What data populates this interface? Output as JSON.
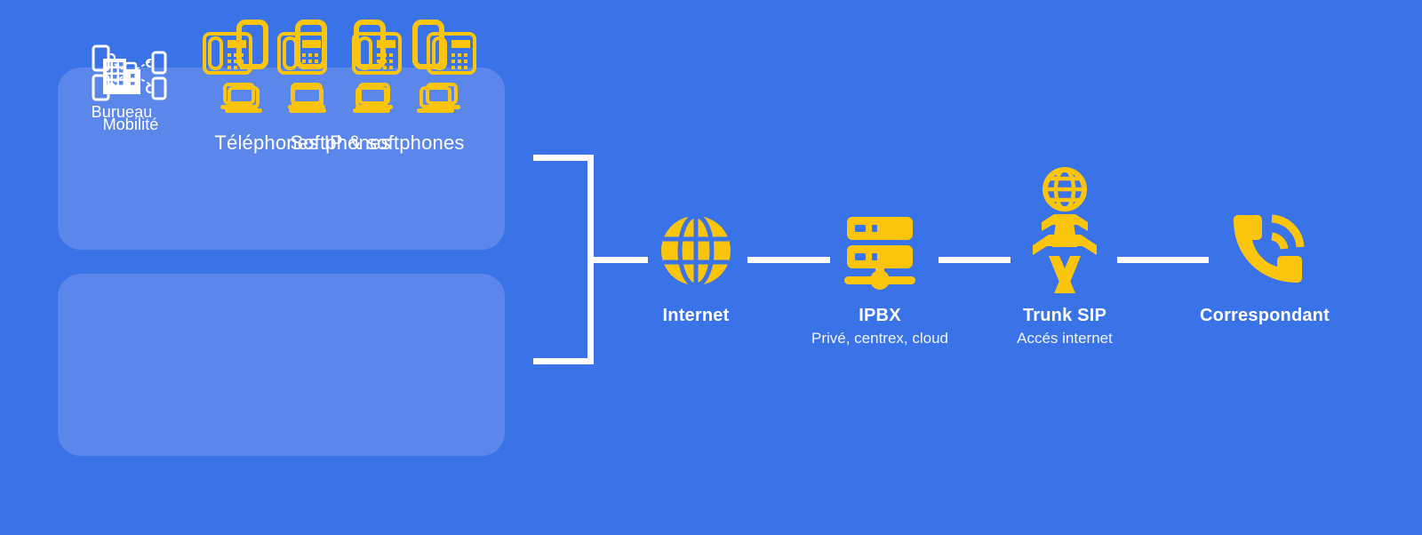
{
  "theme": {
    "background": "#3a72e8",
    "card_background": "#5b87ea",
    "accent_yellow": "#fbc40d",
    "text_white": "#ffffff"
  },
  "cards": [
    {
      "id": "office",
      "side_icon": "office-building-icon",
      "side_label": "Burueau",
      "device_rows": [
        {
          "icon": "desk-phone-icon",
          "count": 4
        },
        {
          "icon": "laptop-icon",
          "count": 4
        }
      ],
      "caption": "Téléphones IP & softphones"
    },
    {
      "id": "mobility",
      "side_icon": "mobility-network-icon",
      "side_label": "Mobilité",
      "device_rows": [
        {
          "icon": "smartphone-icon",
          "count": 4
        },
        {
          "icon": "laptop-icon",
          "count": 4
        }
      ],
      "caption": "Softphones"
    }
  ],
  "nodes": [
    {
      "id": "internet",
      "icon": "globe-icon",
      "title": "Internet",
      "subtitle": ""
    },
    {
      "id": "ipbx",
      "icon": "server-icon",
      "title": "IPBX",
      "subtitle": "Privé, centrex, cloud"
    },
    {
      "id": "trunk",
      "icon": "sip-tower-icon",
      "title": "Trunk SIP",
      "subtitle": "Accés internet"
    },
    {
      "id": "correspondant",
      "icon": "phone-in-talk-icon",
      "title": "Correspondant",
      "subtitle": ""
    }
  ],
  "connectors": {
    "bracket_label": "bracket-connector",
    "segments": [
      "bracket-to-internet",
      "internet-to-ipbx",
      "ipbx-to-trunk",
      "trunk-to-correspondant"
    ]
  }
}
